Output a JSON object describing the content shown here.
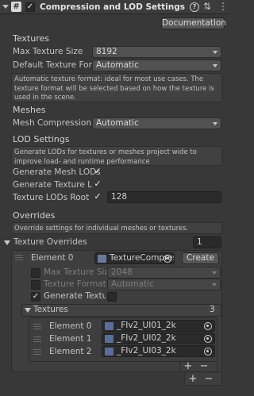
{
  "header": {
    "title": "Compression and LOD Settings (Needle)",
    "help_glyph": "?",
    "settings_glyph": "⇅",
    "menu_glyph": "⋮",
    "icon": "script-hash-icon",
    "documentation_label": "Documentation"
  },
  "textures": {
    "heading": "Textures",
    "max_texture_size_label": "Max Texture Size",
    "max_texture_size_value": "8192",
    "default_format_label": "Default Texture Format",
    "default_format_value": "Automatic",
    "info": "Automatic texture format: ideal for most use cases. The texture format will be selected based on how the texture is used in the scene."
  },
  "meshes": {
    "heading": "Meshes",
    "mesh_compression_label": "Mesh Compression",
    "mesh_compression_value": "Automatic"
  },
  "lod": {
    "heading": "LOD Settings",
    "info": "Generate LODs for textures or meshes project wide to improve load- and runtime performance",
    "generate_mesh_lods_label": "Generate Mesh LODs",
    "generate_mesh_lods_checked": true,
    "generate_texture_lods_label": "Generate Texture LODs",
    "generate_texture_lods_checked": true,
    "texture_lods_root_size_label": "Texture LODs Root Size",
    "texture_lods_root_size_checked": true,
    "texture_lods_root_size_value": "128"
  },
  "overrides": {
    "heading": "Overrides",
    "info": "Override settings for individual meshes or textures.",
    "texture_overrides_label": "Texture Overrides",
    "texture_overrides_count": "1",
    "element0": {
      "label": "Element 0",
      "asset": "TextureCompressionSettings",
      "create_label": "Create",
      "max_texture_size_label": "Max Texture Size",
      "max_texture_size_value": "2048",
      "texture_format_label": "Texture Format",
      "texture_format_value": "Automatic",
      "generate_texture_lods_label": "Generate Texture LODs",
      "generate_texture_lods_checked": true,
      "textures_label": "Textures",
      "textures_count": "3",
      "textures": [
        {
          "label": "Element 0",
          "value": "_FIv2_UI01_2k"
        },
        {
          "label": "Element 1",
          "value": "_FIv2_UI02_2k"
        },
        {
          "label": "Element 2",
          "value": "_FIv2_UI03_2k"
        }
      ]
    }
  },
  "plus_label": "+",
  "minus_label": "−"
}
